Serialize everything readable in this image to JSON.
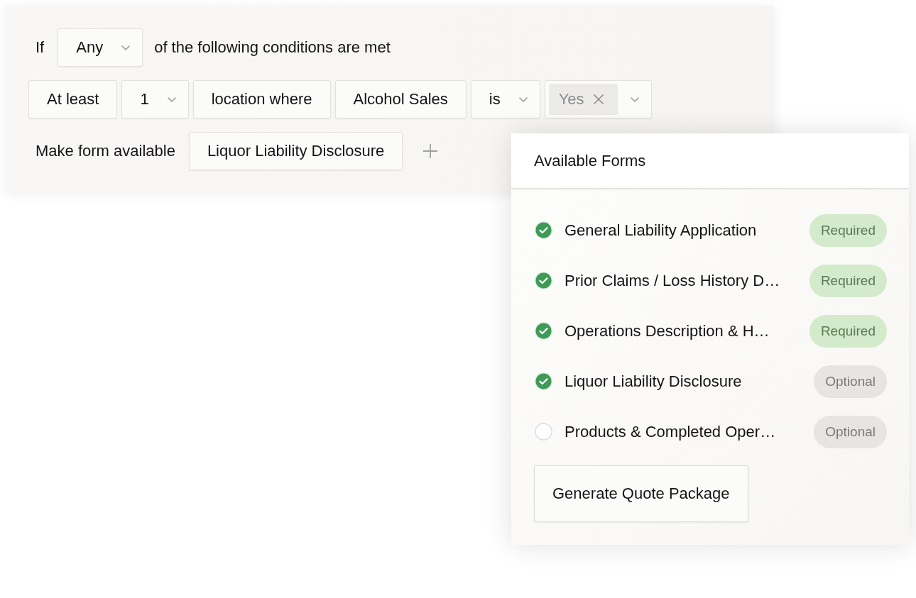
{
  "rule": {
    "rows": [
      {
        "parts": [
          {
            "kind": "label",
            "text": "If"
          },
          {
            "kind": "dropdown",
            "value": "Any"
          },
          {
            "kind": "label",
            "text": "of the following conditions are met"
          }
        ]
      },
      {
        "parts": [
          {
            "kind": "field",
            "value": "At least"
          },
          {
            "kind": "dropdown",
            "value": "1"
          },
          {
            "kind": "field",
            "value": "location where"
          },
          {
            "kind": "field",
            "value": "Alcohol Sales"
          },
          {
            "kind": "dropdown",
            "value": "is"
          },
          {
            "kind": "multiselect",
            "values": [
              "Yes"
            ]
          }
        ]
      },
      {
        "parts": [
          {
            "kind": "label",
            "text": "Make form available"
          },
          {
            "kind": "field",
            "value": "Liquor Liability Disclosure"
          },
          {
            "kind": "add"
          }
        ]
      }
    ]
  },
  "available_forms": {
    "title": "Available Forms",
    "items": [
      {
        "name": "General Liability Application",
        "checked": true,
        "badge": {
          "kind": "required",
          "text": "Required"
        }
      },
      {
        "name": "Prior Claims / Loss History D…",
        "checked": true,
        "badge": {
          "kind": "required",
          "text": "Required"
        }
      },
      {
        "name": "Operations Description & H…",
        "checked": true,
        "badge": {
          "kind": "required",
          "text": "Required"
        }
      },
      {
        "name": "Liquor Liability Disclosure",
        "checked": true,
        "badge": {
          "kind": "optional",
          "text": "Optional"
        }
      },
      {
        "name": "Products & Completed Oper…",
        "checked": false,
        "badge": {
          "kind": "optional",
          "text": "Optional"
        }
      }
    ],
    "button": "Generate Quote Package"
  }
}
